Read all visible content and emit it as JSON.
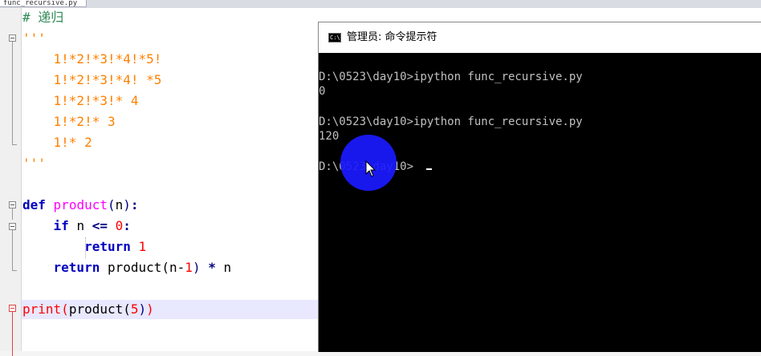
{
  "editor": {
    "tab_label": "func_recursive.py",
    "lines": {
      "l1": "# 递归",
      "l2": "'''",
      "l3": "    1!*2!*3!*4!*5!",
      "l4": "    1!*2!*3!*4! *5",
      "l5": "    1!*2!*3!* 4",
      "l6": "    1!*2!* 3",
      "l7": "    1!* 2",
      "l8": "'''",
      "def_kw": "def",
      "def_name": "product",
      "def_open": "(",
      "def_param": "n",
      "def_close": ")",
      "def_colon": ":",
      "if_kw": "if",
      "if_var": "n",
      "if_op": "<=",
      "if_num": "0",
      "if_colon": ":",
      "ret1_kw": "return",
      "ret1_num": "1",
      "ret2_kw": "return",
      "ret2_call": "product(n-",
      "ret2_num": "1",
      "ret2_close": ")",
      "ret2_op": "*",
      "ret2_var": "n",
      "print_kw": "print",
      "print_open": "(",
      "print_call": "product(",
      "print_num": "5",
      "print_close1": ")",
      "print_close2": ")"
    }
  },
  "console": {
    "title": "管理员: 命令提示符",
    "icon_text": "C:\\",
    "lines": [
      "D:\\0523\\day10>ipython func_recursive.py",
      "0",
      "D:\\0523\\day10>ipython func_recursive.py",
      "120",
      "D:\\0523\\day10>"
    ]
  }
}
